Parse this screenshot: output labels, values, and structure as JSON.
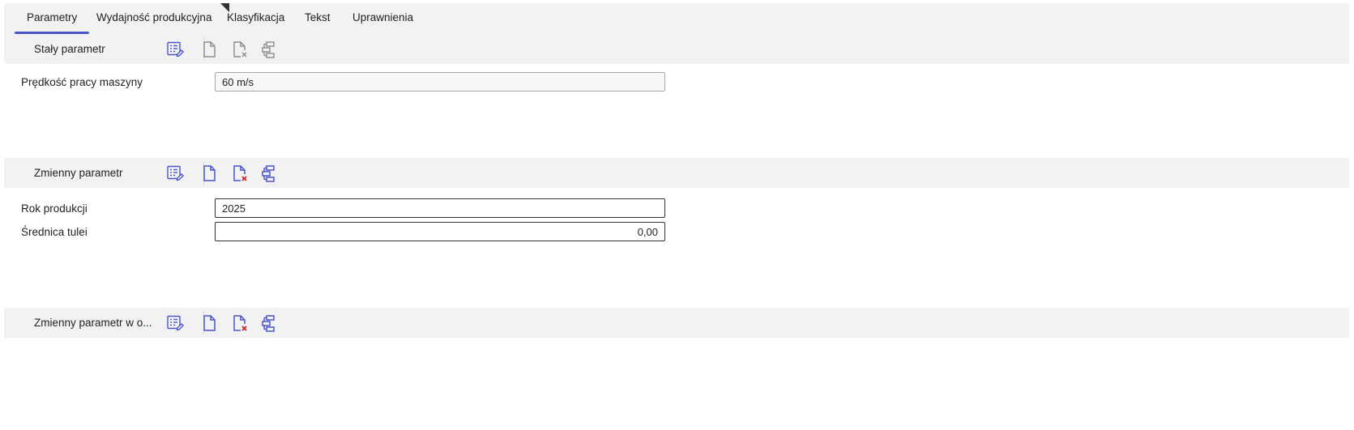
{
  "tabs": [
    {
      "label": "Parametry",
      "active": true
    },
    {
      "label": "Wydajność produkcyjna"
    },
    {
      "label": "Klasyfikacja"
    },
    {
      "label": "Tekst"
    },
    {
      "label": "Uprawnienia"
    }
  ],
  "colors": {
    "accent": "#4a55c8",
    "disabled_icon": "#8c8c8c",
    "delete_mark": "#d32020"
  },
  "sections": {
    "fixed": {
      "title": "Stały parametr",
      "toolbar_icons": [
        "list-edit-icon",
        "new-document-icon",
        "delete-document-icon",
        "hierarchy-icon"
      ],
      "toolbar_enabled": false,
      "fields": [
        {
          "label": "Prędkość pracy maszyny",
          "value": "60 m/s"
        }
      ]
    },
    "variable": {
      "title": "Zmienny parametr",
      "toolbar_icons": [
        "list-edit-icon",
        "new-document-icon",
        "delete-document-icon",
        "hierarchy-icon"
      ],
      "toolbar_enabled": true,
      "fields": [
        {
          "label": "Rok produkcji",
          "value": "2025"
        },
        {
          "label": "Średnica tulei",
          "value": "0,00"
        }
      ]
    },
    "variable_order": {
      "title": "Zmienny parametr w o...",
      "toolbar_icons": [
        "list-edit-icon",
        "new-document-icon",
        "delete-document-icon",
        "hierarchy-icon"
      ],
      "toolbar_enabled": true
    }
  }
}
